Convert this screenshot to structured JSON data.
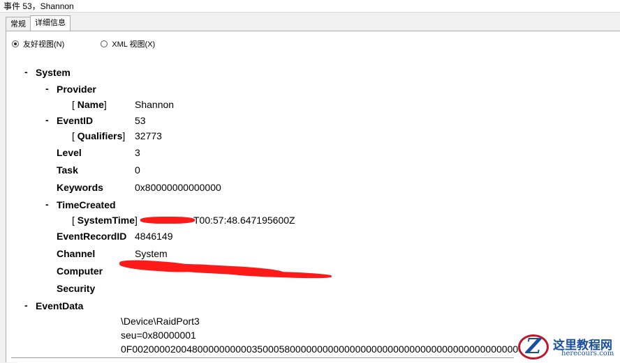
{
  "window": {
    "title": "事件 53，Shannon"
  },
  "tabs": [
    {
      "label": "常规"
    },
    {
      "label": "详细信息"
    }
  ],
  "view_options": [
    {
      "label": "友好视图(N)"
    },
    {
      "label": "XML 视图(X)"
    }
  ],
  "tree": {
    "system": "System",
    "provider": "Provider",
    "name_key": "Name",
    "name_val": "Shannon",
    "eventid_key": "EventID",
    "eventid_val": "53",
    "qualifiers_key": "Qualifiers",
    "qualifiers_val": "32773",
    "level_key": "Level",
    "level_val": "3",
    "task_key": "Task",
    "task_val": "0",
    "keywords_key": "Keywords",
    "keywords_val": "0x80000000000000",
    "timecreated": "TimeCreated",
    "systemtime_key": "SystemTime",
    "systemtime_val": "T00:57:48.647195600Z",
    "recordid_key": "EventRecordID",
    "recordid_val": "4846149",
    "channel_key": "Channel",
    "channel_val": "System",
    "computer_key": "Computer",
    "security_key": "Security",
    "eventdata": "EventData",
    "data_lines": [
      "\\Device\\RaidPort3",
      "seu=0x80000001",
      "0F00200002004800000000003500058000000000000000000000000000000000000000000000"
    ]
  },
  "watermark": {
    "title": "这里教程网",
    "url": "herecours.com"
  },
  "colors": {
    "redaction": "#ff1a1a",
    "watermark_blue": "#1a4fa0",
    "watermark_red": "#c0162a"
  }
}
